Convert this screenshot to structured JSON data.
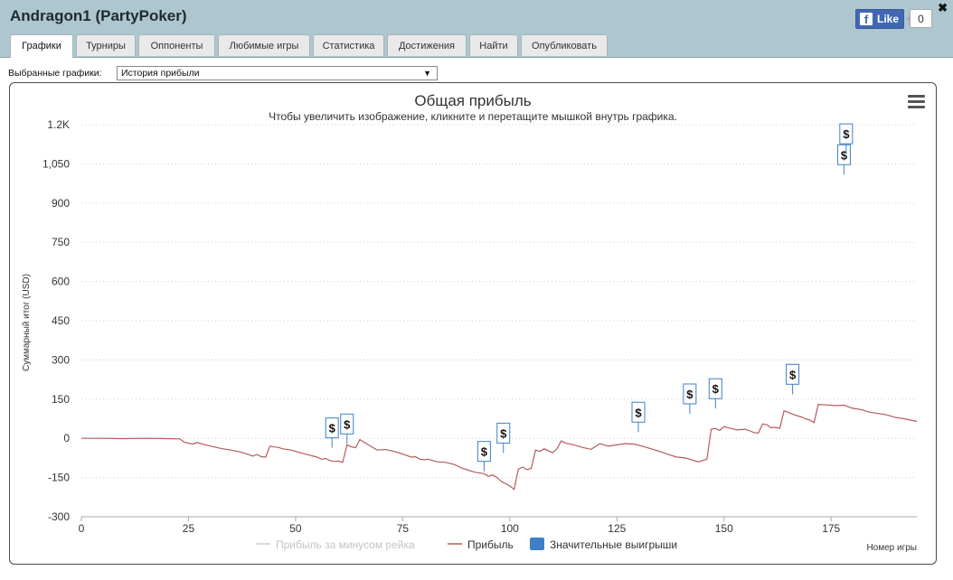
{
  "window": {
    "title": "Andragon1 (PartyPoker)",
    "close_glyph": "✖",
    "facebook": {
      "icon_glyph": "f",
      "like_label": "Like",
      "like_count": "0"
    }
  },
  "tabs": [
    {
      "label": "Графики",
      "active": true
    },
    {
      "label": "Турниры",
      "active": false
    },
    {
      "label": "Оппоненты",
      "active": false
    },
    {
      "label": "Любимые игры",
      "active": false
    },
    {
      "label": "Статистика",
      "active": false
    },
    {
      "label": "Достижения",
      "active": false
    },
    {
      "label": "Найти",
      "active": false
    },
    {
      "label": "Опубликовать",
      "active": false
    }
  ],
  "selector": {
    "label": "Выбранные графики:",
    "value": "История прибыли",
    "arrow": "▼"
  },
  "colors": {
    "titlebar": "#adc6cf",
    "profit_line": "#b55a5a",
    "flag_border": "#3d80c8",
    "legend_marker": "#3d80c8",
    "grid": "#cfcfcf"
  },
  "chart_data": {
    "type": "line",
    "title": "Общая прибыль",
    "subtitle": "Чтобы увеличить изображение, кликните и перетащите мышкой внутрь графика.",
    "xlabel": "Номер игры",
    "ylabel": "Суммарный итог (USD)",
    "xlim": [
      0,
      195
    ],
    "ylim": [
      -300,
      1200
    ],
    "grid": true,
    "legend_position": "bottom-center",
    "x_ticks": [
      0,
      25,
      50,
      75,
      100,
      125,
      150,
      175
    ],
    "y_ticks": [
      {
        "value": -300,
        "label": "-300"
      },
      {
        "value": -150,
        "label": "-150"
      },
      {
        "value": 0,
        "label": "0"
      },
      {
        "value": 150,
        "label": "150"
      },
      {
        "value": 300,
        "label": "300"
      },
      {
        "value": 450,
        "label": "450"
      },
      {
        "value": 600,
        "label": "600"
      },
      {
        "value": 750,
        "label": "750"
      },
      {
        "value": 900,
        "label": "900"
      },
      {
        "value": 1050,
        "label": "1,050"
      },
      {
        "value": 1200,
        "label": "1.2K"
      }
    ],
    "series": [
      {
        "name": "Прибыль",
        "points": [
          [
            0,
            0
          ],
          [
            5,
            0
          ],
          [
            10,
            -1
          ],
          [
            15,
            0
          ],
          [
            20,
            -1
          ],
          [
            23,
            -2
          ],
          [
            24,
            -15
          ],
          [
            26,
            -22
          ],
          [
            27,
            -16
          ],
          [
            29,
            -25
          ],
          [
            31,
            -33
          ],
          [
            33,
            -40
          ],
          [
            35,
            -45
          ],
          [
            37,
            -52
          ],
          [
            39,
            -62
          ],
          [
            40,
            -68
          ],
          [
            41,
            -62
          ],
          [
            42,
            -70
          ],
          [
            43,
            -72
          ],
          [
            44,
            -30
          ],
          [
            45,
            -33
          ],
          [
            46,
            -35
          ],
          [
            47,
            -40
          ],
          [
            49,
            -45
          ],
          [
            51,
            -55
          ],
          [
            53,
            -63
          ],
          [
            55,
            -72
          ],
          [
            56,
            -80
          ],
          [
            57,
            -77
          ],
          [
            58,
            -85
          ],
          [
            59,
            -88
          ],
          [
            60,
            -87
          ],
          [
            61,
            -92
          ],
          [
            62,
            -25
          ],
          [
            63,
            -32
          ],
          [
            64,
            -36
          ],
          [
            65,
            -5
          ],
          [
            66,
            -15
          ],
          [
            67,
            -25
          ],
          [
            68,
            -35
          ],
          [
            69,
            -45
          ],
          [
            71,
            -43
          ],
          [
            73,
            -50
          ],
          [
            75,
            -60
          ],
          [
            77,
            -72
          ],
          [
            78,
            -70
          ],
          [
            79,
            -80
          ],
          [
            80,
            -82
          ],
          [
            81,
            -80
          ],
          [
            83,
            -90
          ],
          [
            85,
            -92
          ],
          [
            87,
            -100
          ],
          [
            89,
            -115
          ],
          [
            91,
            -125
          ],
          [
            92,
            -130
          ],
          [
            94,
            -135
          ],
          [
            95,
            -145
          ],
          [
            96,
            -140
          ],
          [
            97,
            -150
          ],
          [
            98,
            -165
          ],
          [
            100,
            -182
          ],
          [
            101,
            -195
          ],
          [
            102,
            -118
          ],
          [
            103,
            -110
          ],
          [
            104,
            -120
          ],
          [
            105,
            -115
          ],
          [
            106,
            -45
          ],
          [
            107,
            -50
          ],
          [
            108,
            -40
          ],
          [
            110,
            -55
          ],
          [
            111,
            -40
          ],
          [
            112,
            -10
          ],
          [
            113,
            -18
          ],
          [
            115,
            -25
          ],
          [
            117,
            -35
          ],
          [
            119,
            -42
          ],
          [
            121,
            -20
          ],
          [
            123,
            -30
          ],
          [
            125,
            -25
          ],
          [
            127,
            -20
          ],
          [
            129,
            -22
          ],
          [
            131,
            -30
          ],
          [
            133,
            -40
          ],
          [
            135,
            -50
          ],
          [
            137,
            -62
          ],
          [
            139,
            -72
          ],
          [
            141,
            -75
          ],
          [
            143,
            -85
          ],
          [
            144,
            -90
          ],
          [
            145,
            -85
          ],
          [
            146,
            -80
          ],
          [
            147,
            35
          ],
          [
            148,
            38
          ],
          [
            149,
            30
          ],
          [
            150,
            45
          ],
          [
            151,
            40
          ],
          [
            153,
            32
          ],
          [
            155,
            35
          ],
          [
            157,
            22
          ],
          [
            158,
            20
          ],
          [
            159,
            55
          ],
          [
            160,
            52
          ],
          [
            161,
            40
          ],
          [
            162,
            42
          ],
          [
            163,
            38
          ],
          [
            164,
            105
          ],
          [
            165,
            100
          ],
          [
            166,
            92
          ],
          [
            168,
            82
          ],
          [
            169,
            75
          ],
          [
            170,
            70
          ],
          [
            171,
            60
          ],
          [
            172,
            130
          ],
          [
            174,
            128
          ],
          [
            176,
            125
          ],
          [
            178,
            127
          ],
          [
            180,
            115
          ],
          [
            182,
            110
          ],
          [
            184,
            100
          ],
          [
            186,
            95
          ],
          [
            188,
            90
          ],
          [
            190,
            80
          ],
          [
            192,
            75
          ],
          [
            194,
            68
          ],
          [
            195,
            65
          ]
        ]
      }
    ],
    "legend": [
      {
        "label": "Прибыль за минусом рейка",
        "color": "#cccccc",
        "marker": "line"
      },
      {
        "label": "Прибыль",
        "color": "#b55a5a",
        "marker": "line"
      },
      {
        "label": "Значительные выигрыши",
        "color": "#3d80c8",
        "marker": "square"
      }
    ],
    "flags": [
      {
        "x": 58.5,
        "y": 40,
        "label": "$"
      },
      {
        "x": 62,
        "y": 55,
        "label": "$"
      },
      {
        "x": 94,
        "y": -50,
        "label": "$"
      },
      {
        "x": 98.5,
        "y": 20,
        "label": "$"
      },
      {
        "x": 130,
        "y": 100,
        "label": "$"
      },
      {
        "x": 142,
        "y": 170,
        "label": "$"
      },
      {
        "x": 148,
        "y": 190,
        "label": "$"
      },
      {
        "x": 166,
        "y": 245,
        "label": "$"
      },
      {
        "x": 178,
        "y": 1085,
        "label": "$"
      },
      {
        "x": 178.5,
        "y": 1165,
        "label": "$"
      }
    ]
  }
}
